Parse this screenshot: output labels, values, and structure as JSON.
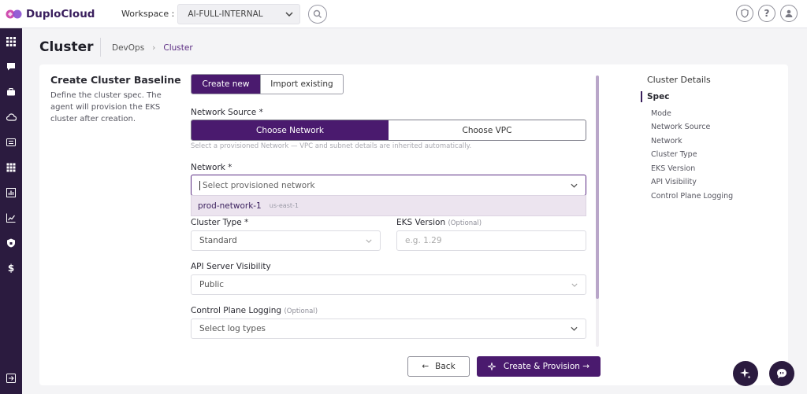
{
  "app": {
    "brand": "DuploCloud",
    "accent": "#4a1a6e",
    "sidebar_bg": "#2b1b3f"
  },
  "workspace": {
    "label": "Workspace :",
    "value": "AI-FULL-INTERNAL"
  },
  "page": {
    "title": "Cluster",
    "breadcrumb": [
      "DevOps",
      "Cluster"
    ]
  },
  "form": {
    "title": "Create Cluster Baseline",
    "description": "Define the cluster spec. The agent will provision the EKS cluster after creation.",
    "mode_tabs": {
      "create_new": "Create new",
      "import_existing": "Import existing",
      "selected": "Create new"
    },
    "network_source": {
      "label": "Network Source *",
      "options": [
        "Choose Network",
        "Choose VPC"
      ],
      "selected": "Choose Network",
      "hint": "Select a provisioned Network — VPC and subnet details are inherited automatically."
    },
    "network": {
      "label": "Network *",
      "placeholder": "Select provisioned network",
      "dropdown_options": [
        {
          "name": "prod-network-1",
          "region": "us-east-1"
        }
      ]
    },
    "cluster_type": {
      "label": "Cluster Type *",
      "value": "Standard"
    },
    "eks_version": {
      "label": "EKS Version",
      "optional": "(Optional)",
      "placeholder": "e.g. 1.29"
    },
    "api_visibility": {
      "label": "API Server Visibility",
      "value": "Public"
    },
    "control_plane_logging": {
      "label": "Control Plane Logging",
      "optional": "(Optional)",
      "placeholder": "Select log types"
    },
    "buttons": {
      "back": "Back",
      "create": "Create & Provision →"
    }
  },
  "details_nav": {
    "title": "Cluster Details",
    "section": "Spec",
    "items": [
      "Mode",
      "Network Source",
      "Network",
      "Cluster Type",
      "EKS Version",
      "API Visibility",
      "Control Plane Logging"
    ]
  }
}
